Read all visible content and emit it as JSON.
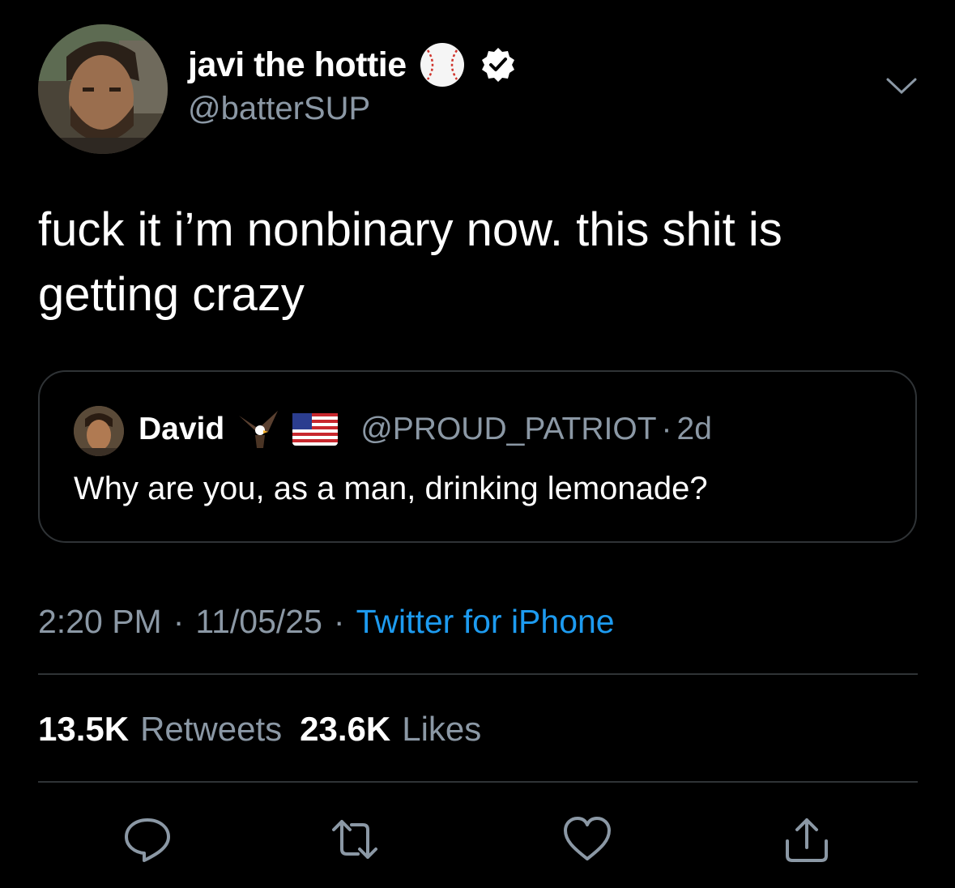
{
  "author": {
    "display_name": "javi the hottie",
    "handle": "@batterSUP",
    "emoji": "baseball-icon",
    "verified": true
  },
  "tweet": {
    "text": "fuck it i’m nonbinary now. this shit is getting crazy"
  },
  "quote": {
    "name": "David",
    "emojis": [
      "eagle-icon",
      "us-flag-icon"
    ],
    "handle": "@PROUD_PATRIOT",
    "separator": "·",
    "time": "2d",
    "text": "Why are you, as a man, drinking lemonade?"
  },
  "meta": {
    "time": "2:20 PM",
    "date": "11/05/25",
    "separator": "·",
    "source": "Twitter for iPhone"
  },
  "stats": {
    "retweets_count": "13.5K",
    "retweets_label": "Retweets",
    "likes_count": "23.6K",
    "likes_label": "Likes"
  },
  "actions": [
    "reply-icon",
    "retweet-icon",
    "like-icon",
    "share-icon"
  ],
  "colors": {
    "background": "#000000",
    "text": "#ffffff",
    "secondary": "#8b98a5",
    "accent": "#1d9bf0",
    "border": "#2f3336"
  }
}
